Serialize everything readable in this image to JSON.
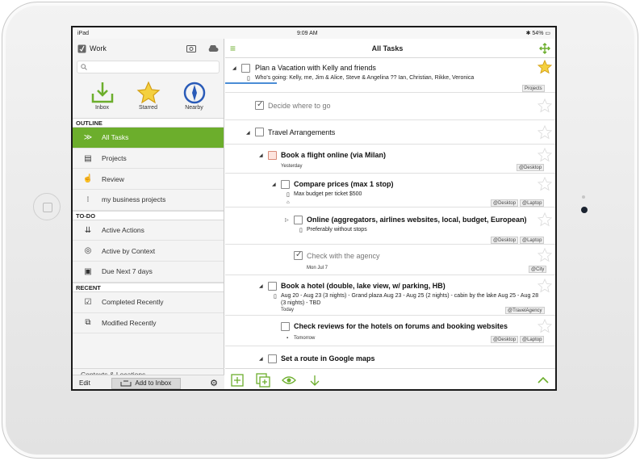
{
  "status": {
    "device": "iPad",
    "time": "9:09 AM",
    "battery": "54%"
  },
  "sidebar": {
    "title": "Work",
    "search_placeholder": "",
    "quick": [
      {
        "label": "Inbox",
        "icon": "inbox-icon"
      },
      {
        "label": "Starred",
        "icon": "star-icon"
      },
      {
        "label": "Nearby",
        "icon": "compass-icon"
      }
    ],
    "sections": {
      "outline": "OUTLINE",
      "todo": "TO-DO",
      "recent": "RECENT"
    },
    "outline_items": [
      "All Tasks",
      "Projects",
      "Review",
      "my business projects"
    ],
    "todo_items": [
      "Active Actions",
      "Active by Context",
      "Due Next 7 days"
    ],
    "recent_items": [
      "Completed Recently",
      "Modified Recently"
    ],
    "bottom_item": "Contexts & Locations",
    "footer": {
      "edit": "Edit",
      "add_inbox": "Add to Inbox"
    }
  },
  "main": {
    "title": "All Tasks",
    "tasks": [
      {
        "title": "Plan a Vacation with Kelly and friends",
        "note": "Who's going: Kelly, me, Jim & Alice, Steve & Angelina ?? Ian, Christian, Rikke, Veronica",
        "tags": [
          "Projects"
        ],
        "starred": true
      },
      {
        "title": "Decide where to go",
        "done": true
      },
      {
        "title": "Travel Arrangements"
      },
      {
        "title": "Book a flight online (via Milan)",
        "meta": "Yesterday",
        "tags": [
          "@Desktop"
        ]
      },
      {
        "title": "Compare prices (max 1 stop)",
        "note": "Max budget per ticket $500",
        "tags": [
          "@Desktop",
          "@Laptop"
        ]
      },
      {
        "title": "Online (aggregators, airlines websites, local, budget, European)",
        "note": "Preferably without stops",
        "tags": [
          "@Desktop",
          "@Laptop"
        ]
      },
      {
        "title": "Check with the agency",
        "done": true,
        "meta": "Mon Jul 7",
        "tags": [
          "@City"
        ]
      },
      {
        "title": "Book a hotel (double, lake view, w/ parking, HB)",
        "note": "Aug 20 - Aug 23 (3 nights) - Grand plaza Aug 23 - Aug 25 (2 nights) - cabin by the lake Aug 25 - Aug 28 (3 nights) - TBD",
        "meta": "Today",
        "tags": [
          "@TravelAgency"
        ]
      },
      {
        "title": "Check reviews for the hotels on forums and booking websites",
        "meta": "Tomorrow",
        "tags": [
          "@Desktop",
          "@Laptop"
        ]
      },
      {
        "title": "Set a route in Google maps"
      }
    ]
  }
}
